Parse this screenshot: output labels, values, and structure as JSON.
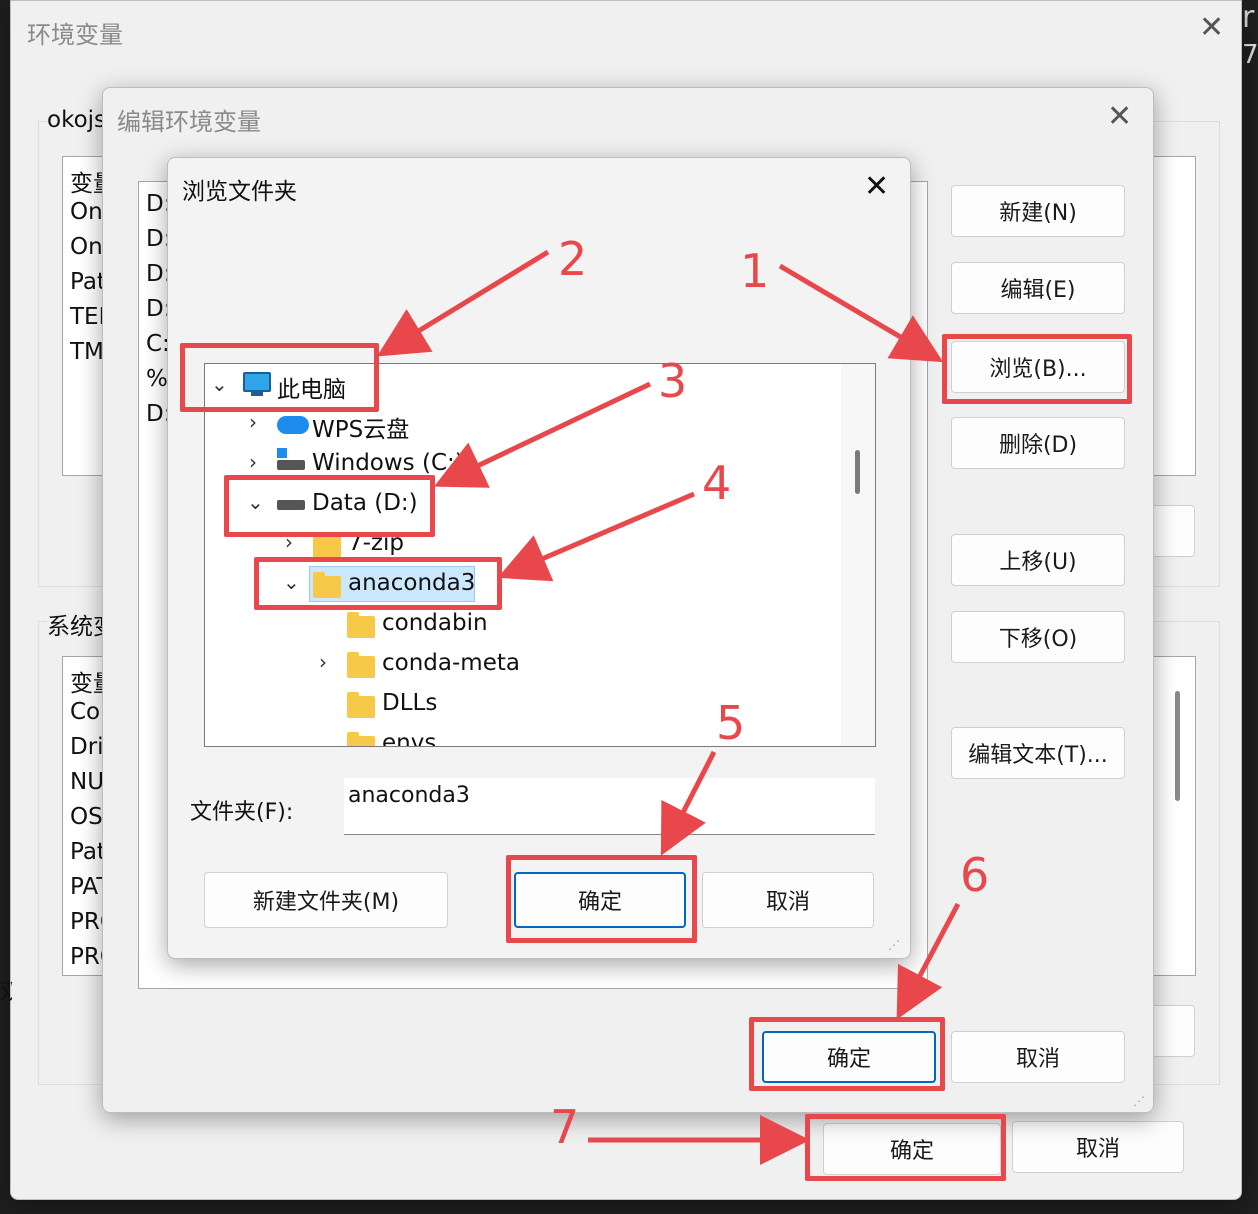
{
  "env_window": {
    "title": "环境变量",
    "user_group_label": "okojs",
    "user_list": [
      "变量",
      "On",
      "On",
      "Pat",
      "TEN",
      "TM"
    ],
    "system_group_label": "系统变",
    "system_list": [
      "变量",
      "Cor",
      "Dri",
      "NU",
      "OS",
      "Pat",
      "PAT",
      "PRO",
      "PRO"
    ],
    "ok_label": "确定",
    "cancel_label": "取消",
    "left_edge_char": "双",
    "right_edge_chars": [
      "r",
      "7"
    ]
  },
  "edit_window": {
    "title": "编辑环境变量",
    "path_list": [
      "D:",
      "D:",
      "D:",
      "D:",
      "C:",
      "%",
      "D:"
    ],
    "buttons": {
      "new": "新建(N)",
      "edit": "编辑(E)",
      "browse": "浏览(B)...",
      "delete": "删除(D)",
      "move_up": "上移(U)",
      "move_down": "下移(O)",
      "edit_text": "编辑文本(T)...",
      "ok": "确定",
      "cancel": "取消"
    }
  },
  "browse_dialog": {
    "title": "浏览文件夹",
    "tree": {
      "this_pc": "此电脑",
      "wps": "WPS云盘",
      "windows_c": "Windows (C:)",
      "data_d": "Data (D:)",
      "zip7": "7-zip",
      "anaconda3": "anaconda3",
      "condabin": "condabin",
      "conda_meta": "conda-meta",
      "dlls": "DLLs",
      "envs": "envs"
    },
    "folder_label": "文件夹(F):",
    "folder_value": "anaconda3",
    "new_folder_label": "新建文件夹(M)",
    "ok_label": "确定",
    "cancel_label": "取消"
  },
  "annotations": [
    "1",
    "2",
    "3",
    "4",
    "5",
    "6",
    "7"
  ],
  "colors": {
    "annotation": "#e8484c",
    "selection": "#cce8ff",
    "default_border": "#0067c0"
  }
}
